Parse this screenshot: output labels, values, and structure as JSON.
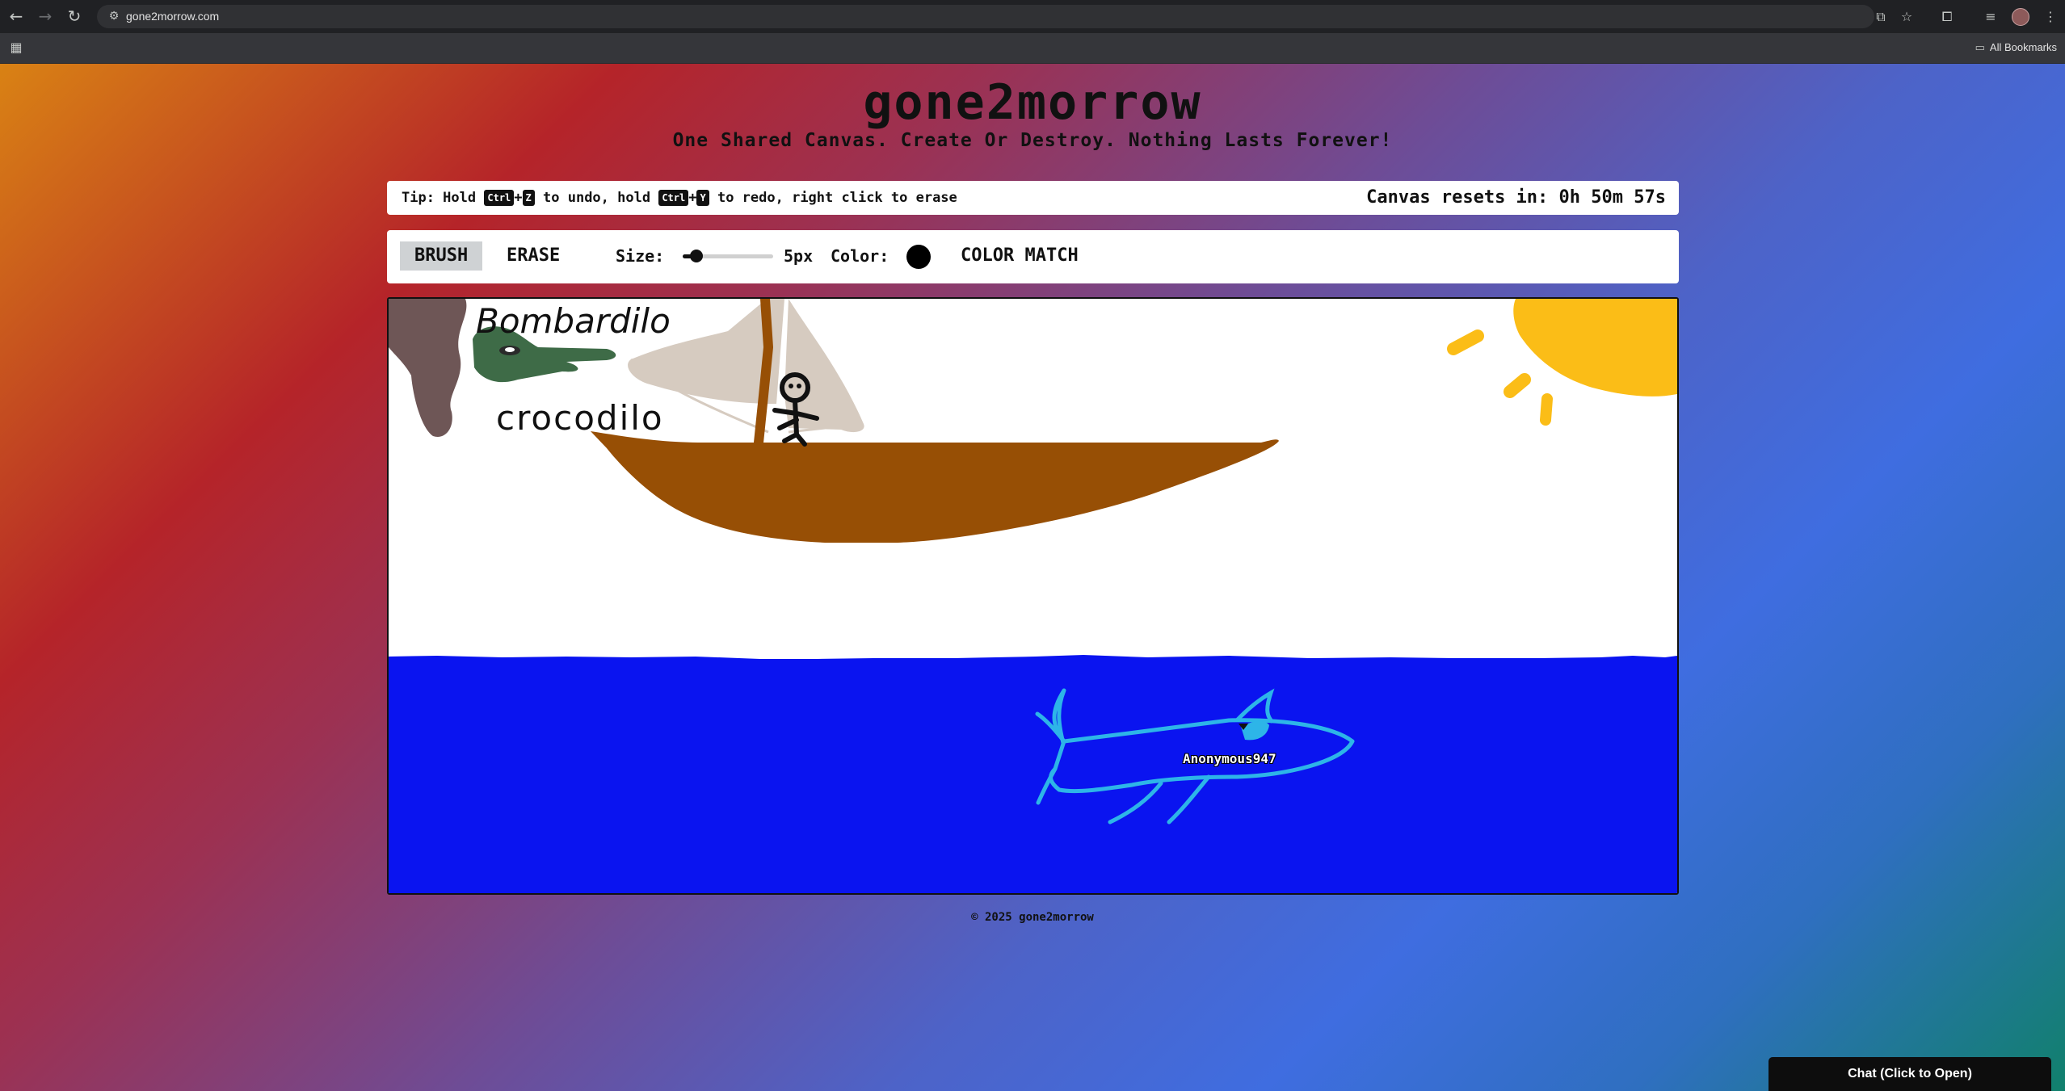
{
  "browser": {
    "url": "gone2morrow.com",
    "bookmarks_label": "All Bookmarks"
  },
  "site": {
    "title": "gone2morrow",
    "subtitle": "One Shared Canvas. Create Or Destroy. Nothing Lasts Forever!"
  },
  "tips": {
    "prefix": "Tip: Hold",
    "ctrl_key": "Ctrl",
    "plus": "+",
    "z_key": "Z",
    "mid": "to undo, hold",
    "y_key": "Y",
    "suffix": "to redo, right click to erase",
    "reset_label": "Canvas resets in:",
    "reset_value": "0h 50m 57s"
  },
  "toolbar": {
    "brush_label": "BRUSH",
    "erase_label": "ERASE",
    "size_label": "Size:",
    "size_value": "5px",
    "size_fraction": 0.15,
    "color_label": "Color:",
    "color_value": "#000000",
    "color_match_label": "COLOR MATCH",
    "active_tool": "BRUSH"
  },
  "canvas": {
    "drawn_text_1": "Bombardilo",
    "drawn_text_2": "crocodilo",
    "cursor_user": "Anonymous947",
    "colors": {
      "sea": "#0a14f0",
      "boat": "#974f05",
      "sail": "#d6cbc0",
      "sun": "#fbbd17",
      "shark": "#2db5e8",
      "smoke": "#6e5656",
      "croc": "#3e6b47"
    }
  },
  "footer": {
    "text": "© 2025 gone2morrow"
  },
  "chat": {
    "label": "Chat (Click to Open)"
  }
}
